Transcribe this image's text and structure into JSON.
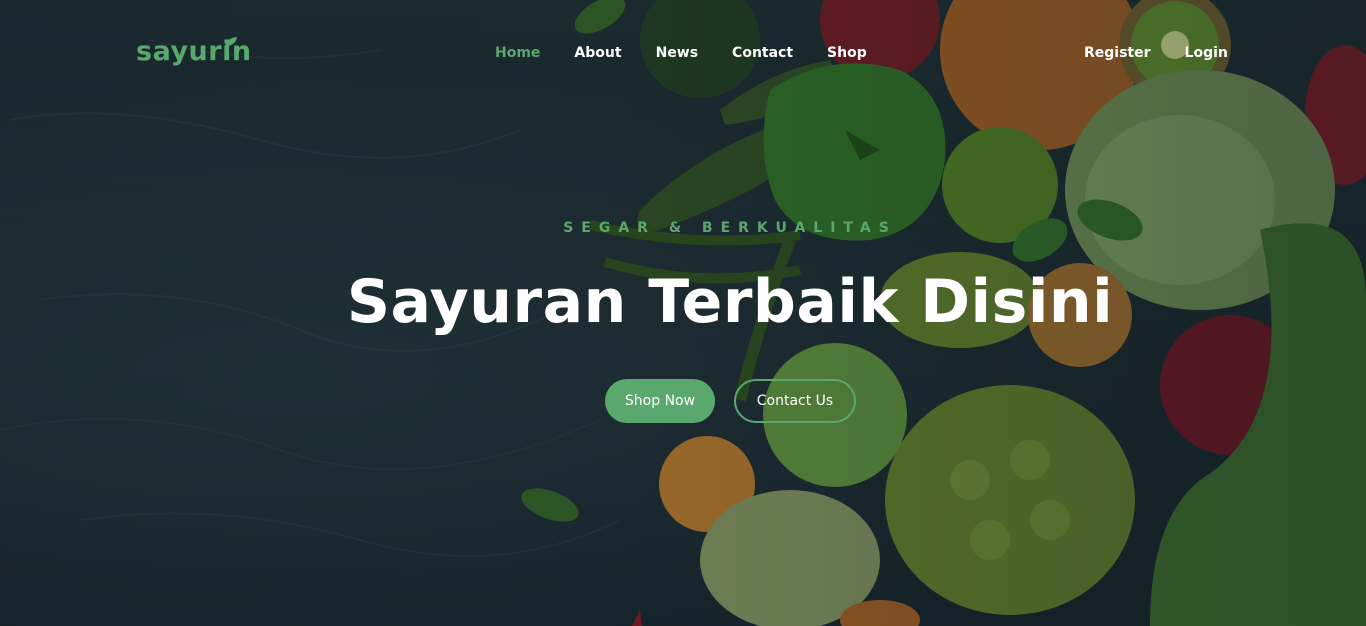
{
  "brand": {
    "name": "sayurin",
    "color": "#5aa86d"
  },
  "nav": {
    "items": [
      {
        "label": "Home",
        "active": true
      },
      {
        "label": "About",
        "active": false
      },
      {
        "label": "News",
        "active": false
      },
      {
        "label": "Contact",
        "active": false
      },
      {
        "label": "Shop",
        "active": false
      }
    ],
    "auth": {
      "register": "Register",
      "login": "Login"
    }
  },
  "hero": {
    "tagline": "SEGAR & BERKUALITAS",
    "headline": "Sayuran Terbaik Disini",
    "primary_button": "Shop Now",
    "secondary_button": "Contact Us",
    "accent": "#5aa86d",
    "background": "#17252a"
  }
}
